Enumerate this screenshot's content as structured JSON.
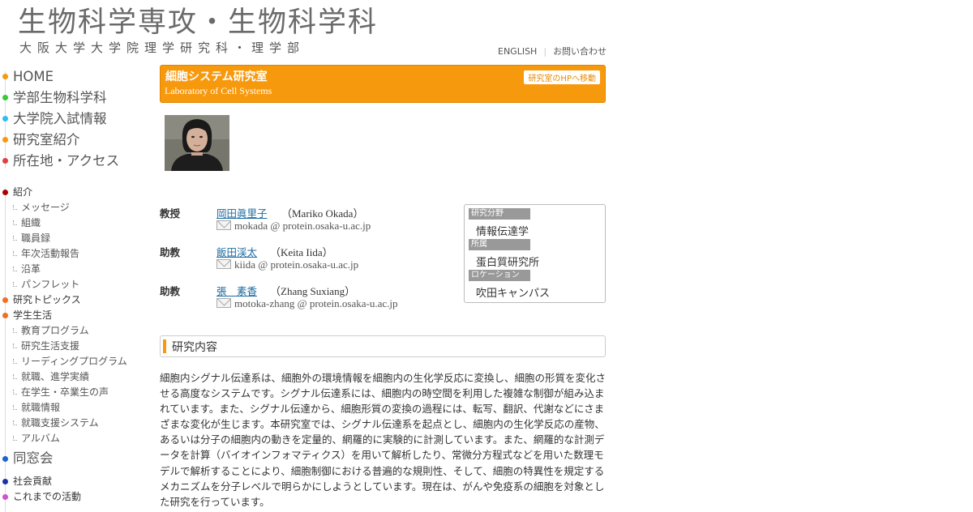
{
  "header": {
    "title": "生物科学専攻・生物科学科",
    "subtitle": "大阪大学大学院理学研究科・理学部",
    "links": [
      "ENGLISH",
      "お問い合わせ"
    ]
  },
  "nav_main": [
    {
      "label": "HOME",
      "color": "#f7990d"
    },
    {
      "label": "学部生物科学科",
      "color": "#33cc33"
    },
    {
      "label": "大学院入試情報",
      "color": "#33bbee"
    },
    {
      "label": "研究室紹介",
      "color": "#f7990d"
    },
    {
      "label": "所在地・アクセス",
      "color": "#e04040"
    }
  ],
  "nav_sub": {
    "intro": {
      "label": "紹介",
      "color": "#aa0000"
    },
    "intro_items": [
      "メッセージ",
      "組織",
      "職員録",
      "年次活動報告",
      "沿革",
      "パンフレット"
    ],
    "topics": {
      "label": "研究トピックス",
      "color": "#f07020"
    },
    "student": {
      "label": "学生生活",
      "color": "#f07020"
    },
    "student_items": [
      "教育プログラム",
      "研究生活支援",
      "リーディングプログラム",
      "就職、進学実績",
      "在学生・卒業生の声",
      "就職情報",
      "就職支援システム",
      "アルバム"
    ],
    "alumni": {
      "label": "同窓会",
      "color": "#1a66cc"
    },
    "social": {
      "label": "社会貢献",
      "color": "#1a33aa"
    },
    "past": {
      "label": "これまでの活動",
      "color": "#cc55cc"
    }
  },
  "lab": {
    "name": "細胞システム研究室",
    "name_en": "Laboratory of Cell Systems",
    "hp_button": "研究室のHPへ移動",
    "color": "#f7990d"
  },
  "staff": [
    {
      "role": "教授",
      "name": "岡田眞里子",
      "name_en": "（Mariko Okada）",
      "email": "mokada @ protein.osaka-u.ac.jp"
    },
    {
      "role": "助教",
      "name": "飯田渓太",
      "name_en": "（Keita Iida）",
      "email": "kiida @ protein.osaka-u.ac.jp"
    },
    {
      "role": "助教",
      "name": "張　素香",
      "name_en": "（Zhang Suxiang）",
      "email": "motoka-zhang @ protein.osaka-u.ac.jp"
    }
  ],
  "info": [
    {
      "label": "研究分野",
      "value": "情報伝達学"
    },
    {
      "label": "所属",
      "value": "蛋白質研究所"
    },
    {
      "label": "ロケーション",
      "value": "吹田キャンパス"
    }
  ],
  "research": {
    "heading": "研究内容",
    "text": "細胞内シグナル伝達系は、細胞外の環境情報を細胞内の生化学反応に変換し、細胞の形質を変化させる高度なシステムです。シグナル伝達系には、細胞内の時空間を利用した複雑な制御が組み込まれています。また、シグナル伝達から、細胞形質の変換の過程には、転写、翻訳、代謝などにさまざまな変化が生じます。本研究室では、シグナル伝達系を起点とし、細胞内の生化学反応の産物、あるいは分子の細胞内の動きを定量的、網羅的に実験的に計測しています。また、網羅的な計測データを計算（バイオインフォマティクス）を用いて解析したり、常微分方程式などを用いた数理モデルで解析することにより、細胞制御における普遍的な規則性、そして、細胞の特異性を規定するメカニズムを分子レベルで明らかにしようとしています。現在は、がんや免疫系の細胞を対象とした研究を行っています。"
  }
}
